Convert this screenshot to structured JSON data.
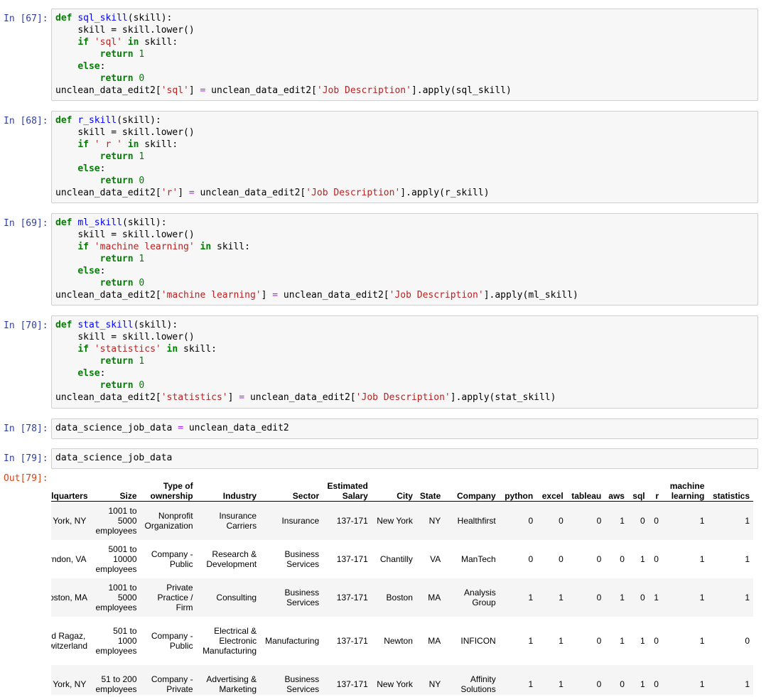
{
  "cells": [
    {
      "prompt": "In [67]:"
    },
    {
      "prompt": "In [68]:"
    },
    {
      "prompt": "In [69]:"
    },
    {
      "prompt": "In [70]:"
    },
    {
      "prompt": "In [78]:",
      "code": "data_science_job_data = unclean_data_edit2"
    },
    {
      "prompt": "In [79]:",
      "code": "data_science_job_data"
    }
  ],
  "output_prompt": "Out[79]:",
  "functions": [
    {
      "name": "sql_skill",
      "needle": "'sql'",
      "col": "'sql'",
      "fn": "sql_skill"
    },
    {
      "name": "r_skill",
      "needle": "' r '",
      "col": "'r'",
      "fn": "r_skill"
    },
    {
      "name": "ml_skill",
      "needle": "'machine learning'",
      "col": "'machine learning'",
      "fn": "ml_skill"
    },
    {
      "name": "stat_skill",
      "needle": "'statistics'",
      "col": "'statistics'",
      "fn": "stat_skill"
    }
  ],
  "code_tokens": {
    "def": "def",
    "arg": "(skill):",
    "lower_line": "skill = skill.lower()",
    "if": "if",
    "in": "in",
    "skill_colon": " skill:",
    "return": "return",
    "one": "1",
    "zero": "0",
    "else": "else",
    "colon": ":",
    "df": "unclean_data_edit2",
    "jobdesc": "'Job Description'",
    "apply": ".apply("
  },
  "table": {
    "headers": [
      [
        "lquarters"
      ],
      [
        "Size"
      ],
      [
        "Type of",
        "ownership"
      ],
      [
        "Industry"
      ],
      [
        "Sector"
      ],
      [
        "Estimated",
        "Salary"
      ],
      [
        "City"
      ],
      [
        "State"
      ],
      [
        "Company"
      ],
      [
        "python"
      ],
      [
        "excel"
      ],
      [
        "tableau"
      ],
      [
        "aws"
      ],
      [
        "sql"
      ],
      [
        "r"
      ],
      [
        "machine",
        "learning"
      ],
      [
        "statistics"
      ]
    ],
    "rows": [
      [
        [
          "' York, NY"
        ],
        [
          "1001 to",
          "5000",
          "employees"
        ],
        [
          "Nonprofit",
          "Organization"
        ],
        [
          "Insurance",
          "Carriers"
        ],
        [
          "Insurance"
        ],
        [
          "137-171"
        ],
        [
          "New York"
        ],
        [
          "NY"
        ],
        [
          "Healthfirst"
        ],
        [
          "0"
        ],
        [
          "0"
        ],
        [
          "0"
        ],
        [
          "1"
        ],
        [
          "0"
        ],
        [
          "0"
        ],
        [
          "1"
        ],
        [
          "1"
        ]
      ],
      [
        [
          "rndon, VA"
        ],
        [
          "5001 to",
          "10000",
          "employees"
        ],
        [
          "Company -",
          "Public"
        ],
        [
          "Research &",
          "Development"
        ],
        [
          "Business",
          "Services"
        ],
        [
          "137-171"
        ],
        [
          "Chantilly"
        ],
        [
          "VA"
        ],
        [
          "ManTech"
        ],
        [
          "0"
        ],
        [
          "0"
        ],
        [
          "0"
        ],
        [
          "0"
        ],
        [
          "1"
        ],
        [
          "0"
        ],
        [
          "1"
        ],
        [
          "1"
        ]
      ],
      [
        [
          "oston, MA"
        ],
        [
          "1001 to",
          "5000",
          "employees"
        ],
        [
          "Private",
          "Practice /",
          "Firm"
        ],
        [
          "Consulting"
        ],
        [
          "Business",
          "Services"
        ],
        [
          "137-171"
        ],
        [
          "Boston"
        ],
        [
          "MA"
        ],
        [
          "Analysis",
          "Group"
        ],
        [
          "1"
        ],
        [
          "1"
        ],
        [
          "0"
        ],
        [
          "1"
        ],
        [
          "0"
        ],
        [
          "1"
        ],
        [
          "1"
        ],
        [
          "1"
        ]
      ],
      [
        [
          "ıd Ragaz,",
          "witzerland"
        ],
        [
          "501 to",
          "1000",
          "employees"
        ],
        [
          "Company -",
          "Public"
        ],
        [
          "Electrical &",
          "Electronic",
          "Manufacturing"
        ],
        [
          "Manufacturing"
        ],
        [
          "137-171"
        ],
        [
          "Newton"
        ],
        [
          "MA"
        ],
        [
          "INFICON"
        ],
        [
          "1"
        ],
        [
          "1"
        ],
        [
          "0"
        ],
        [
          "1"
        ],
        [
          "1"
        ],
        [
          "0"
        ],
        [
          "1"
        ],
        [
          "0"
        ]
      ],
      [
        [
          "' York, NY"
        ],
        [
          "51 to 200",
          "employees"
        ],
        [
          "Company -",
          "Private"
        ],
        [
          "Advertising &",
          "Marketing"
        ],
        [
          "Business",
          "Services"
        ],
        [
          "137-171"
        ],
        [
          "New York"
        ],
        [
          "NY"
        ],
        [
          "Affinity",
          "Solutions"
        ],
        [
          "1"
        ],
        [
          "1"
        ],
        [
          "0"
        ],
        [
          "0"
        ],
        [
          "1"
        ],
        [
          "0"
        ],
        [
          "1"
        ],
        [
          "1"
        ]
      ]
    ]
  }
}
